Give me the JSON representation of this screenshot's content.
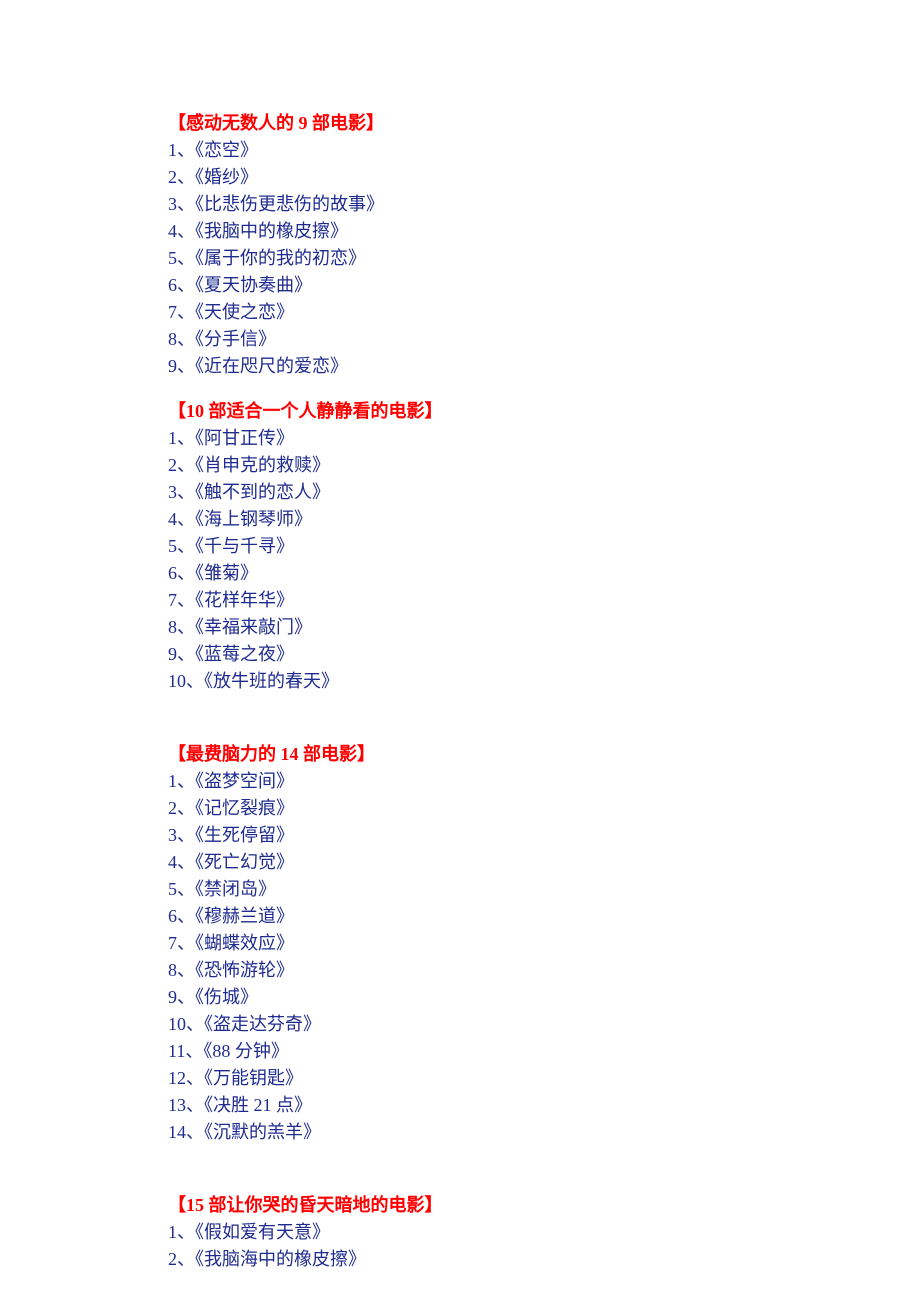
{
  "sections": [
    {
      "title": "【感动无数人的 9 部电影】",
      "items": [
        "1、《恋空》",
        "2、《婚纱》",
        "3、《比悲伤更悲伤的故事》",
        "4、《我脑中的橡皮擦》",
        "5、《属于你的我的初恋》",
        "6、《夏天协奏曲》",
        "7、《天使之恋》",
        "8、《分手信》",
        "9、《近在咫尺的爱恋》"
      ]
    },
    {
      "title": "【10 部适合一个人静静看的电影】",
      "items": [
        "1、《阿甘正传》",
        "2、《肖申克的救赎》",
        "3、《触不到的恋人》",
        "4、《海上钢琴师》",
        "5、《千与千寻》",
        "6、《雏菊》",
        "7、《花样年华》",
        "8、《幸福来敲门》",
        "9、《蓝莓之夜》",
        "10、《放牛班的春天》"
      ]
    },
    {
      "title": "【最费脑力的 14 部电影】",
      "items": [
        "1、《盗梦空间》",
        "2、《记忆裂痕》",
        "3、《生死停留》",
        "4、《死亡幻觉》",
        "5、《禁闭岛》",
        "6、《穆赫兰道》",
        "7、《蝴蝶效应》",
        "8、《恐怖游轮》",
        "9、《伤城》",
        "10、《盗走达芬奇》",
        "11、《88 分钟》",
        "12、《万能钥匙》",
        "13、《决胜 21 点》",
        "14、《沉默的羔羊》"
      ]
    },
    {
      "title": "【15 部让你哭的昏天暗地的电影】",
      "items": [
        "1、《假如爱有天意》",
        "2、《我脑海中的橡皮擦》"
      ]
    }
  ]
}
